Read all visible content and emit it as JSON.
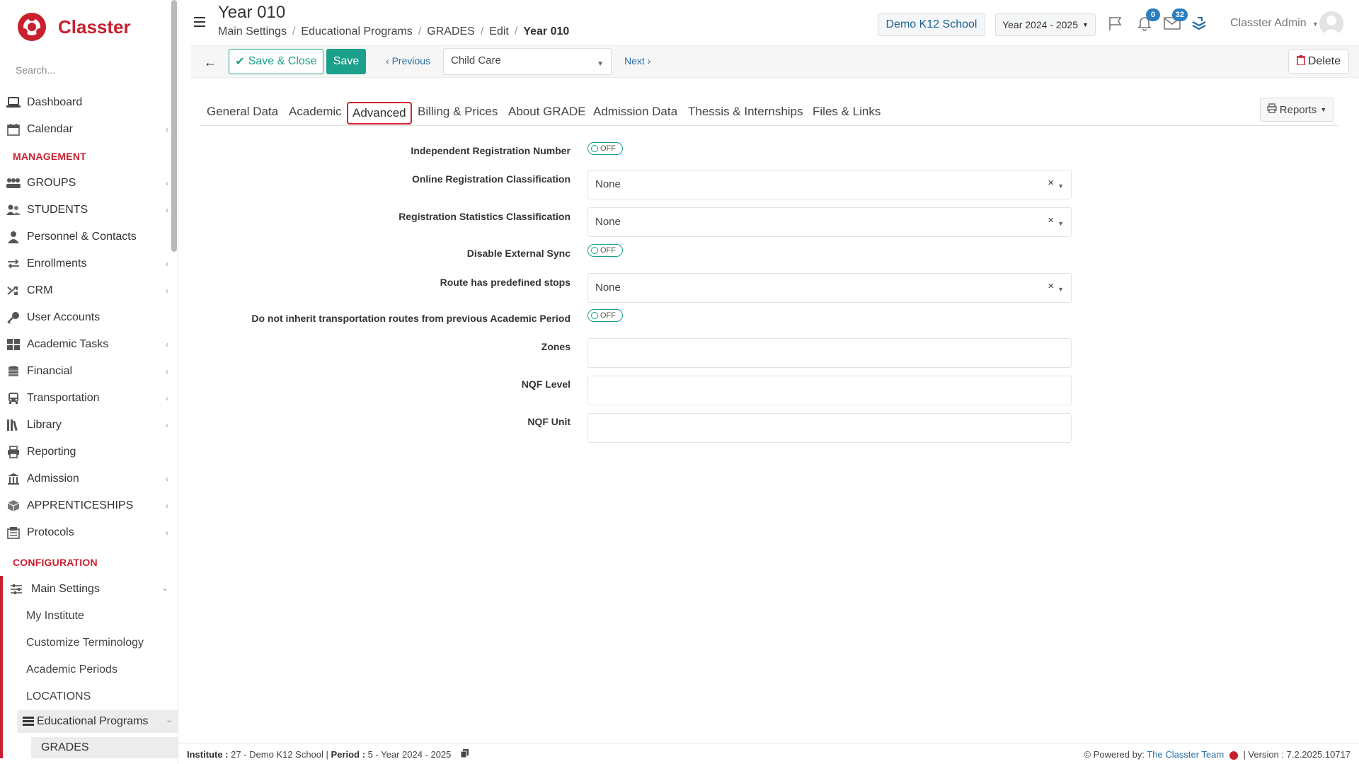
{
  "app": {
    "logo_text": "Classter",
    "brand_color": "#c8202f",
    "accent_color": "#1aa08b"
  },
  "sidebar": {
    "search_placeholder": "Search...",
    "top_items": [
      {
        "label": "Dashboard",
        "icon": "laptop-icon"
      },
      {
        "label": "Calendar",
        "icon": "calendar-icon"
      }
    ],
    "management_title": "MANAGEMENT",
    "management_items": [
      {
        "label": "GROUPS",
        "icon": "groups-icon"
      },
      {
        "label": "STUDENTS",
        "icon": "students-icon"
      },
      {
        "label": "Personnel & Contacts",
        "icon": "person-icon"
      },
      {
        "label": "Enrollments",
        "icon": "exchange-icon"
      },
      {
        "label": "CRM",
        "icon": "shuffle-icon"
      },
      {
        "label": "User Accounts",
        "icon": "key-icon"
      },
      {
        "label": "Academic Tasks",
        "icon": "grid-icon"
      },
      {
        "label": "Financial",
        "icon": "coins-icon"
      },
      {
        "label": "Transportation",
        "icon": "bus-icon"
      },
      {
        "label": "Library",
        "icon": "books-icon"
      },
      {
        "label": "Reporting",
        "icon": "print-icon"
      },
      {
        "label": "Admission",
        "icon": "building-icon"
      },
      {
        "label": "APPRENTICESHIPS",
        "icon": "box-icon"
      },
      {
        "label": "Protocols",
        "icon": "protocol-icon"
      }
    ],
    "configuration_title": "CONFIGURATION",
    "main_settings": "Main Settings",
    "settings_items": [
      "My Institute",
      "Customize Terminology",
      "Academic Periods",
      "LOCATIONS"
    ],
    "educational_programs": "Educational Programs",
    "grades": "GRADES"
  },
  "header": {
    "title": "Year 010",
    "breadcrumb": [
      "Main Settings",
      "Educational Programs",
      "GRADES",
      "Edit"
    ],
    "breadcrumb_current": "Year 010",
    "school": "Demo K12 School",
    "year": "Year 2024 - 2025",
    "notifications_count": "0",
    "messages_count": "32",
    "user": "Classter Admin"
  },
  "toolbar": {
    "save_close": "Save & Close",
    "save": "Save",
    "previous": "Previous",
    "select_value": "Child Care",
    "next": "Next",
    "delete": "Delete"
  },
  "tabs": [
    "General Data",
    "Academic",
    "Advanced",
    "Billing & Prices",
    "About GRADE",
    "Admission Data",
    "Thessis & Internships",
    "Files & Links"
  ],
  "reports": "Reports",
  "form": {
    "independent_registration_number": {
      "label": "Independent Registration Number",
      "value": "OFF"
    },
    "online_registration_classification": {
      "label": "Online Registration Classification",
      "value": "None"
    },
    "registration_statistics_classification": {
      "label": "Registration Statistics Classification",
      "value": "None"
    },
    "disable_external_sync": {
      "label": "Disable External Sync",
      "value": "OFF"
    },
    "route_predefined_stops": {
      "label": "Route has predefined stops",
      "value": "None"
    },
    "do_not_inherit_routes": {
      "label": "Do not inherit transportation routes from previous Academic Period",
      "value": "OFF"
    },
    "zones": {
      "label": "Zones",
      "value": ""
    },
    "nqf_level": {
      "label": "NQF Level",
      "value": ""
    },
    "nqf_unit": {
      "label": "NQF Unit",
      "value": ""
    }
  },
  "footer": {
    "institute_label": "Institute :",
    "institute_value": "27 - Demo K12 School",
    "period_label": "Period :",
    "period_value": "5 - Year 2024 - 2025",
    "powered_by": "Powered by:",
    "powered_team": "The Classter Team",
    "version": "| Version : 7.2.2025.10717"
  }
}
